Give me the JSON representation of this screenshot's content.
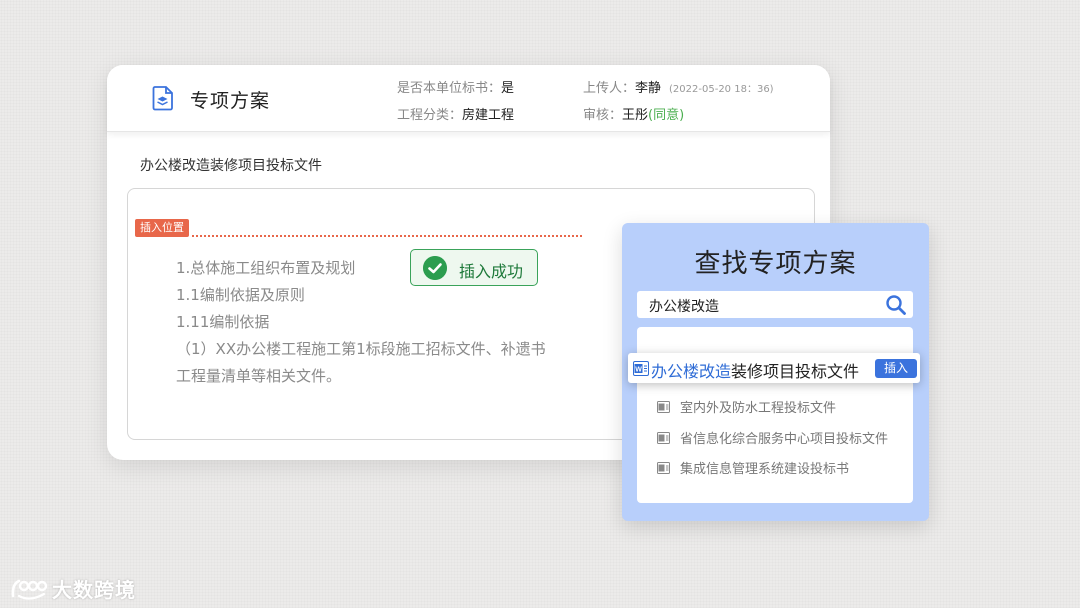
{
  "card": {
    "title": "专项方案",
    "icon": "document-stack-icon",
    "meta": {
      "bid_label": "是否本单位标书：",
      "bid_value": "是",
      "category_label": "工程分类：",
      "category_value": "房建工程",
      "uploader_label": "上传人：",
      "uploader_value": "李静",
      "timestamp": "(2022-05-20  18：36)",
      "reviewer_label": "审核：",
      "reviewer_value": "王彤",
      "review_status": "(同意)"
    },
    "document_name": "办公楼改造装修项目投标文件"
  },
  "editor": {
    "insert_tag": "插入位置",
    "lines": [
      "1.总体施工组织布置及规划",
      "1.1编制依据及原则",
      "1.11编制依据",
      "（1）XX办公楼工程施工第1标段施工招标文件、补遗书",
      "工程量清单等相关文件。"
    ],
    "toast": "插入成功"
  },
  "search_panel": {
    "title": "查找专项方案",
    "query": "办公楼改造",
    "highlight": {
      "match": "办公楼改造",
      "rest": "装修项目投标文件",
      "button": "插入"
    },
    "results": [
      "室内外及防水工程投标文件",
      "省信息化综合服务中心项目投标文件",
      "集成信息管理系统建设投标书"
    ]
  },
  "watermark": "大数跨境",
  "colors": {
    "accent": "#3b73dd",
    "success": "#2c9d4f",
    "insert_marker": "#e8674a",
    "panel_bg": "#b8cffb"
  }
}
